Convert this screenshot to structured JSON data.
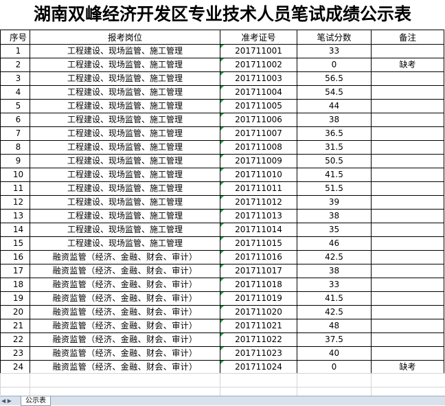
{
  "title": "湖南双峰经济开发区专业技术人员笔试成绩公示表",
  "columns": [
    "序号",
    "报考岗位",
    "准考证号",
    "笔试分数",
    "备注"
  ],
  "rows": [
    {
      "no": "1",
      "position": "工程建设、现场监管、施工管理",
      "id": "201711001",
      "score": "33",
      "note": ""
    },
    {
      "no": "2",
      "position": "工程建设、现场监管、施工管理",
      "id": "201711002",
      "score": "0",
      "note": "缺考"
    },
    {
      "no": "3",
      "position": "工程建设、现场监管、施工管理",
      "id": "201711003",
      "score": "56.5",
      "note": ""
    },
    {
      "no": "4",
      "position": "工程建设、现场监管、施工管理",
      "id": "201711004",
      "score": "54.5",
      "note": ""
    },
    {
      "no": "5",
      "position": "工程建设、现场监管、施工管理",
      "id": "201711005",
      "score": "44",
      "note": ""
    },
    {
      "no": "6",
      "position": "工程建设、现场监管、施工管理",
      "id": "201711006",
      "score": "38",
      "note": ""
    },
    {
      "no": "7",
      "position": "工程建设、现场监管、施工管理",
      "id": "201711007",
      "score": "36.5",
      "note": ""
    },
    {
      "no": "8",
      "position": "工程建设、现场监管、施工管理",
      "id": "201711008",
      "score": "31.5",
      "note": ""
    },
    {
      "no": "9",
      "position": "工程建设、现场监管、施工管理",
      "id": "201711009",
      "score": "50.5",
      "note": ""
    },
    {
      "no": "10",
      "position": "工程建设、现场监管、施工管理",
      "id": "201711010",
      "score": "41.5",
      "note": ""
    },
    {
      "no": "11",
      "position": "工程建设、现场监管、施工管理",
      "id": "201711011",
      "score": "51.5",
      "note": ""
    },
    {
      "no": "12",
      "position": "工程建设、现场监管、施工管理",
      "id": "201711012",
      "score": "39",
      "note": ""
    },
    {
      "no": "13",
      "position": "工程建设、现场监管、施工管理",
      "id": "201711013",
      "score": "38",
      "note": ""
    },
    {
      "no": "14",
      "position": "工程建设、现场监管、施工管理",
      "id": "201711014",
      "score": "35",
      "note": ""
    },
    {
      "no": "15",
      "position": "工程建设、现场监管、施工管理",
      "id": "201711015",
      "score": "46",
      "note": ""
    },
    {
      "no": "16",
      "position": "融资监管（经济、金融、财会、审计）",
      "id": "201711016",
      "score": "42.5",
      "note": ""
    },
    {
      "no": "17",
      "position": "融资监管（经济、金融、财会、审计）",
      "id": "201711017",
      "score": "38",
      "note": ""
    },
    {
      "no": "18",
      "position": "融资监管（经济、金融、财会、审计）",
      "id": "201711018",
      "score": "33",
      "note": ""
    },
    {
      "no": "19",
      "position": "融资监管（经济、金融、财会、审计）",
      "id": "201711019",
      "score": "41.5",
      "note": ""
    },
    {
      "no": "20",
      "position": "融资监管（经济、金融、财会、审计）",
      "id": "201711020",
      "score": "42.5",
      "note": ""
    },
    {
      "no": "21",
      "position": "融资监管（经济、金融、财会、审计）",
      "id": "201711021",
      "score": "48",
      "note": ""
    },
    {
      "no": "22",
      "position": "融资监管（经济、金融、财会、审计）",
      "id": "201711022",
      "score": "37.5",
      "note": ""
    },
    {
      "no": "23",
      "position": "融资监管（经济、金融、财会、审计）",
      "id": "201711023",
      "score": "40",
      "note": ""
    },
    {
      "no": "24",
      "position": "融资监管（经济、金融、财会、审计）",
      "id": "201711024",
      "score": "0",
      "note": "缺考"
    }
  ],
  "sheet_tab": "公示表",
  "colors": {
    "cell_marker": "#1e9e3a",
    "tabbar": "#d9e1ec"
  }
}
